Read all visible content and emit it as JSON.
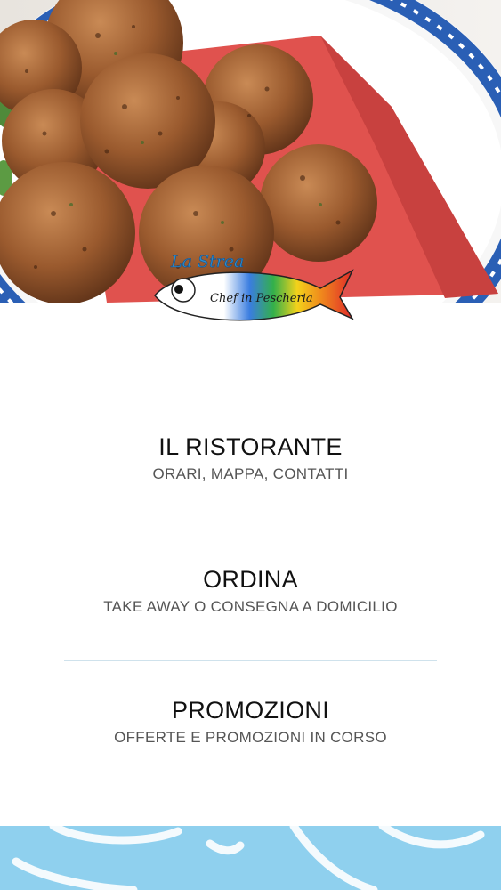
{
  "hero": {
    "image": "fried-fish-balls-on-plate",
    "logo": {
      "script_text": "La Strea",
      "fish_text": "Chef in Pescheria"
    }
  },
  "menu": {
    "items": [
      {
        "title": "IL RISTORANTE",
        "subtitle": "ORARI, MAPPA, CONTATTI"
      },
      {
        "title": "ORDINA",
        "subtitle": "TAKE AWAY O CONSEGNA A DOMICILIO"
      },
      {
        "title": "PROMOZIONI",
        "subtitle": "OFFERTE E PROMOZIONI IN CORSO"
      }
    ]
  },
  "colors": {
    "divider": "#cfe2ec",
    "footer": "#8fd0ee",
    "title_text": "#111111",
    "subtitle_text": "#555555"
  }
}
